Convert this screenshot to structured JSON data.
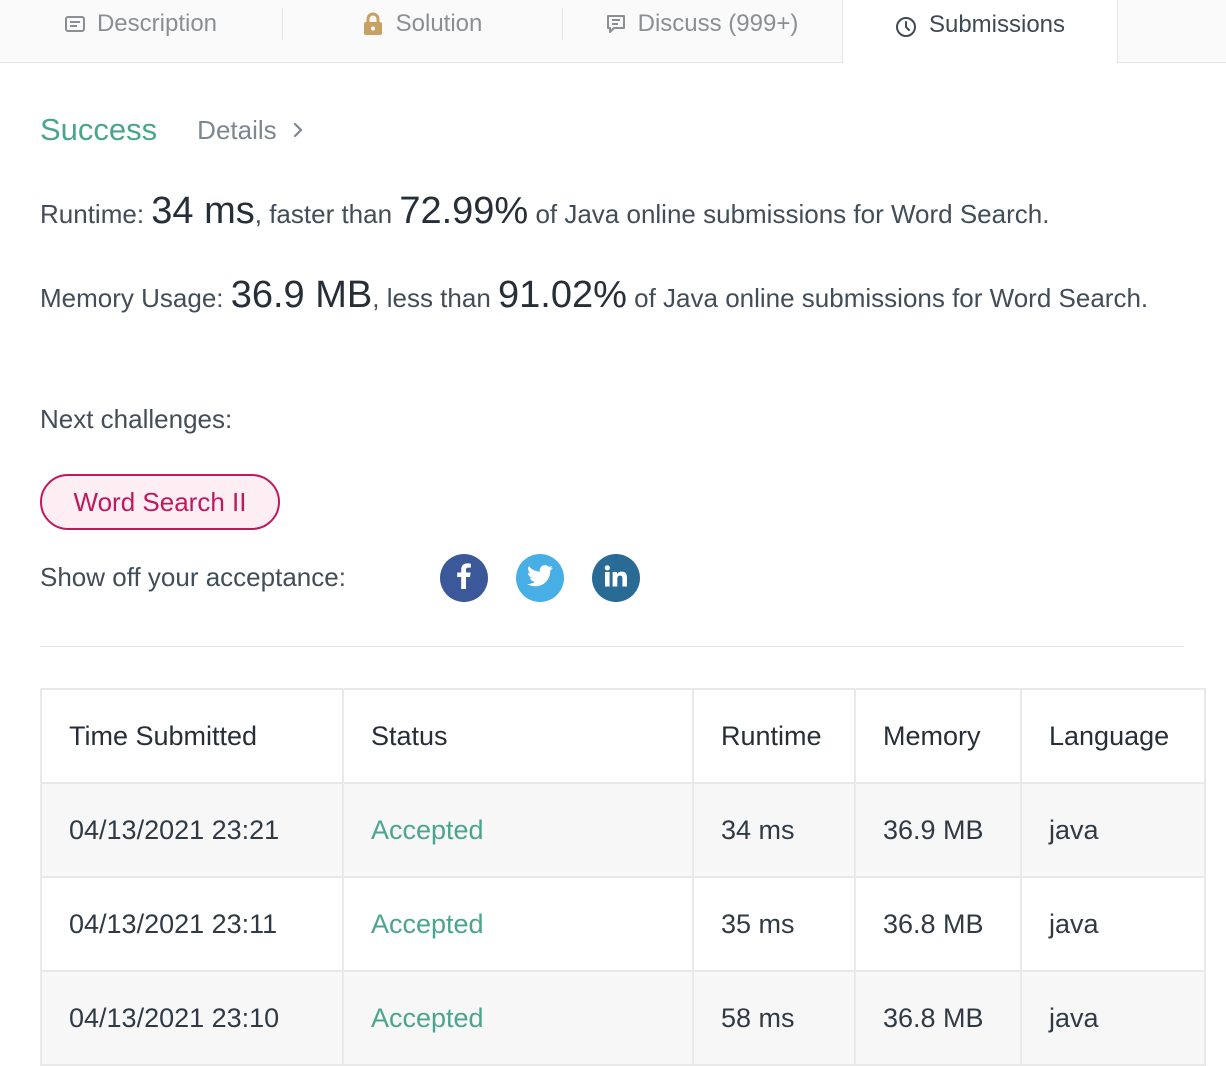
{
  "tabs": [
    {
      "label": "Description",
      "icon": "description-icon"
    },
    {
      "label": "Solution",
      "icon": "lock-icon"
    },
    {
      "label": "Discuss (999+)",
      "icon": "comment-icon"
    },
    {
      "label": "Submissions",
      "icon": "clock-icon",
      "active": true
    }
  ],
  "result": {
    "status": "Success",
    "details_label": "Details",
    "runtime": {
      "label": "Runtime:",
      "value": "34 ms",
      "mid": ", faster than",
      "percent": "72.99%",
      "suffix": "of Java online submissions for Word Search."
    },
    "memory": {
      "label": "Memory Usage:",
      "value": "36.9 MB",
      "mid": ", less than",
      "percent": "91.02%",
      "suffix": "of Java online submissions for Word Search."
    },
    "next_label": "Next challenges:",
    "challenge": "Word Search II",
    "share_label": "Show off your acceptance:",
    "social": [
      "facebook-icon",
      "twitter-icon",
      "linkedin-icon"
    ]
  },
  "table": {
    "headers": [
      "Time Submitted",
      "Status",
      "Runtime",
      "Memory",
      "Language"
    ],
    "rows": [
      [
        "04/13/2021 23:21",
        "Accepted",
        "34 ms",
        "36.9 MB",
        "java"
      ],
      [
        "04/13/2021 23:11",
        "Accepted",
        "35 ms",
        "36.8 MB",
        "java"
      ],
      [
        "04/13/2021 23:10",
        "Accepted",
        "58 ms",
        "36.8 MB",
        "java"
      ]
    ]
  },
  "colors": {
    "accent_green": "#4ba58e",
    "challenge_pink": "#c2185b",
    "lock_gold": "#c9a063",
    "facebook": "#3b5998",
    "twitter": "#47aee6",
    "linkedin": "#2a6b96"
  }
}
